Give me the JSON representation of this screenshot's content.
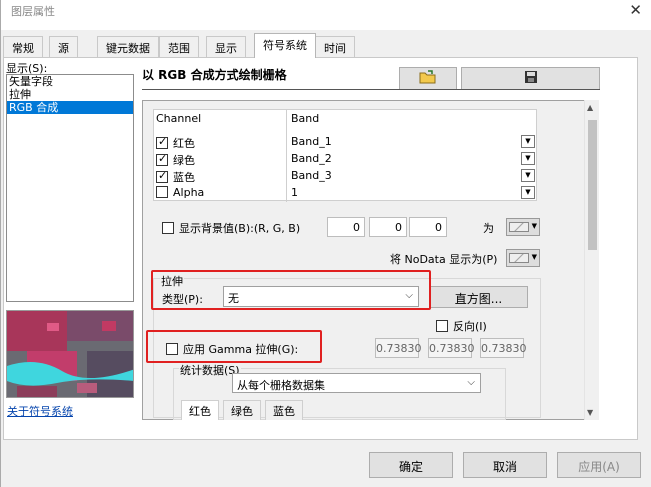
{
  "window": {
    "title": "图层属性",
    "close_icon": "close-icon"
  },
  "tabs": [
    {
      "label": "常规"
    },
    {
      "label": "源"
    },
    {
      "label": "键元数据"
    },
    {
      "label": "范围"
    },
    {
      "label": "显示"
    },
    {
      "label": "符号系统"
    },
    {
      "label": "时间"
    }
  ],
  "left": {
    "show_label": "显示(S):",
    "items": [
      {
        "label": "矢量字段"
      },
      {
        "label": "拉伸"
      },
      {
        "label": "RGB 合成"
      }
    ],
    "about_link": "关于符号系统"
  },
  "main": {
    "heading": "以 RGB 合成方式绘制栅格",
    "folder_icon": "open-folder-icon",
    "save_icon": "save-icon"
  },
  "table": {
    "col1_header": "Channel",
    "col2_header": "Band",
    "rows": [
      {
        "channel": "红色",
        "band": "Band_1",
        "checked": true
      },
      {
        "channel": "绿色",
        "band": "Band_2",
        "checked": true
      },
      {
        "channel": "蓝色",
        "band": "Band_3",
        "checked": true
      },
      {
        "channel": "Alpha",
        "band": "1",
        "checked": false
      }
    ]
  },
  "background": {
    "label": "显示背景值(B):(R, G, B)",
    "r": "0",
    "g": "0",
    "b": "0",
    "as_label": "为",
    "nodata_label": "将 NoData 显示为(P)"
  },
  "stretch": {
    "group_label": "拉伸",
    "type_label": "类型(P):",
    "type_value": "无",
    "histogram_button": "直方图...",
    "invert_label": "反向(I)",
    "gamma_label": "应用 Gamma 拉伸(G):",
    "gamma_values": [
      "0.73830",
      "0.73830",
      "0.73830"
    ],
    "stats_label": "统计数据(S)",
    "stats_value": "从每个栅格数据集",
    "subtabs": [
      {
        "label": "红色"
      },
      {
        "label": "绿色"
      },
      {
        "label": "蓝色"
      }
    ]
  },
  "footer": {
    "ok": "确定",
    "cancel": "取消",
    "apply": "应用(A)"
  },
  "colors": {
    "selection": "#0078d7",
    "highlight_box": "#e02020",
    "link": "#0645ad"
  }
}
